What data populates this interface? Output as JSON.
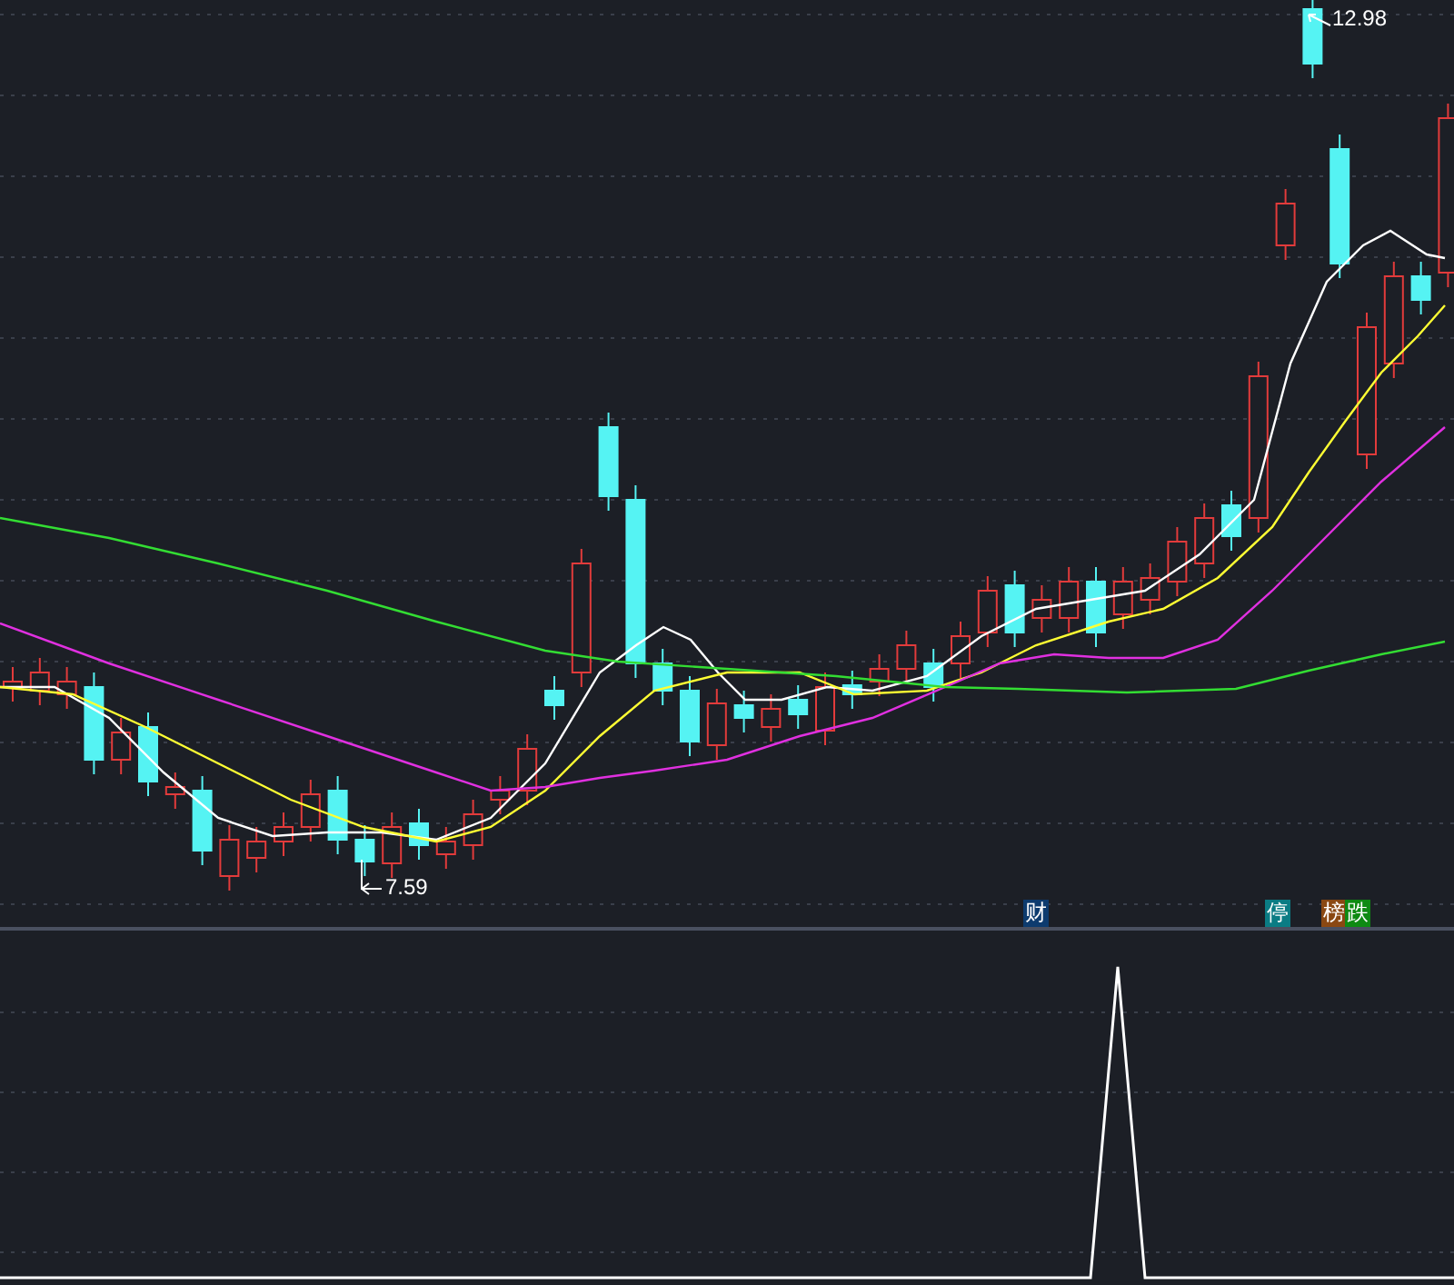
{
  "price_chart": {
    "high_label": "12.98",
    "low_label": "7.59"
  },
  "markers": [
    {
      "label": "财",
      "color": "#0d3b6e"
    },
    {
      "label": "停",
      "color": "#0b7c84"
    },
    {
      "label": "榜",
      "color": "#8a4812"
    },
    {
      "label": "跌",
      "color": "#0e8a12"
    }
  ]
}
